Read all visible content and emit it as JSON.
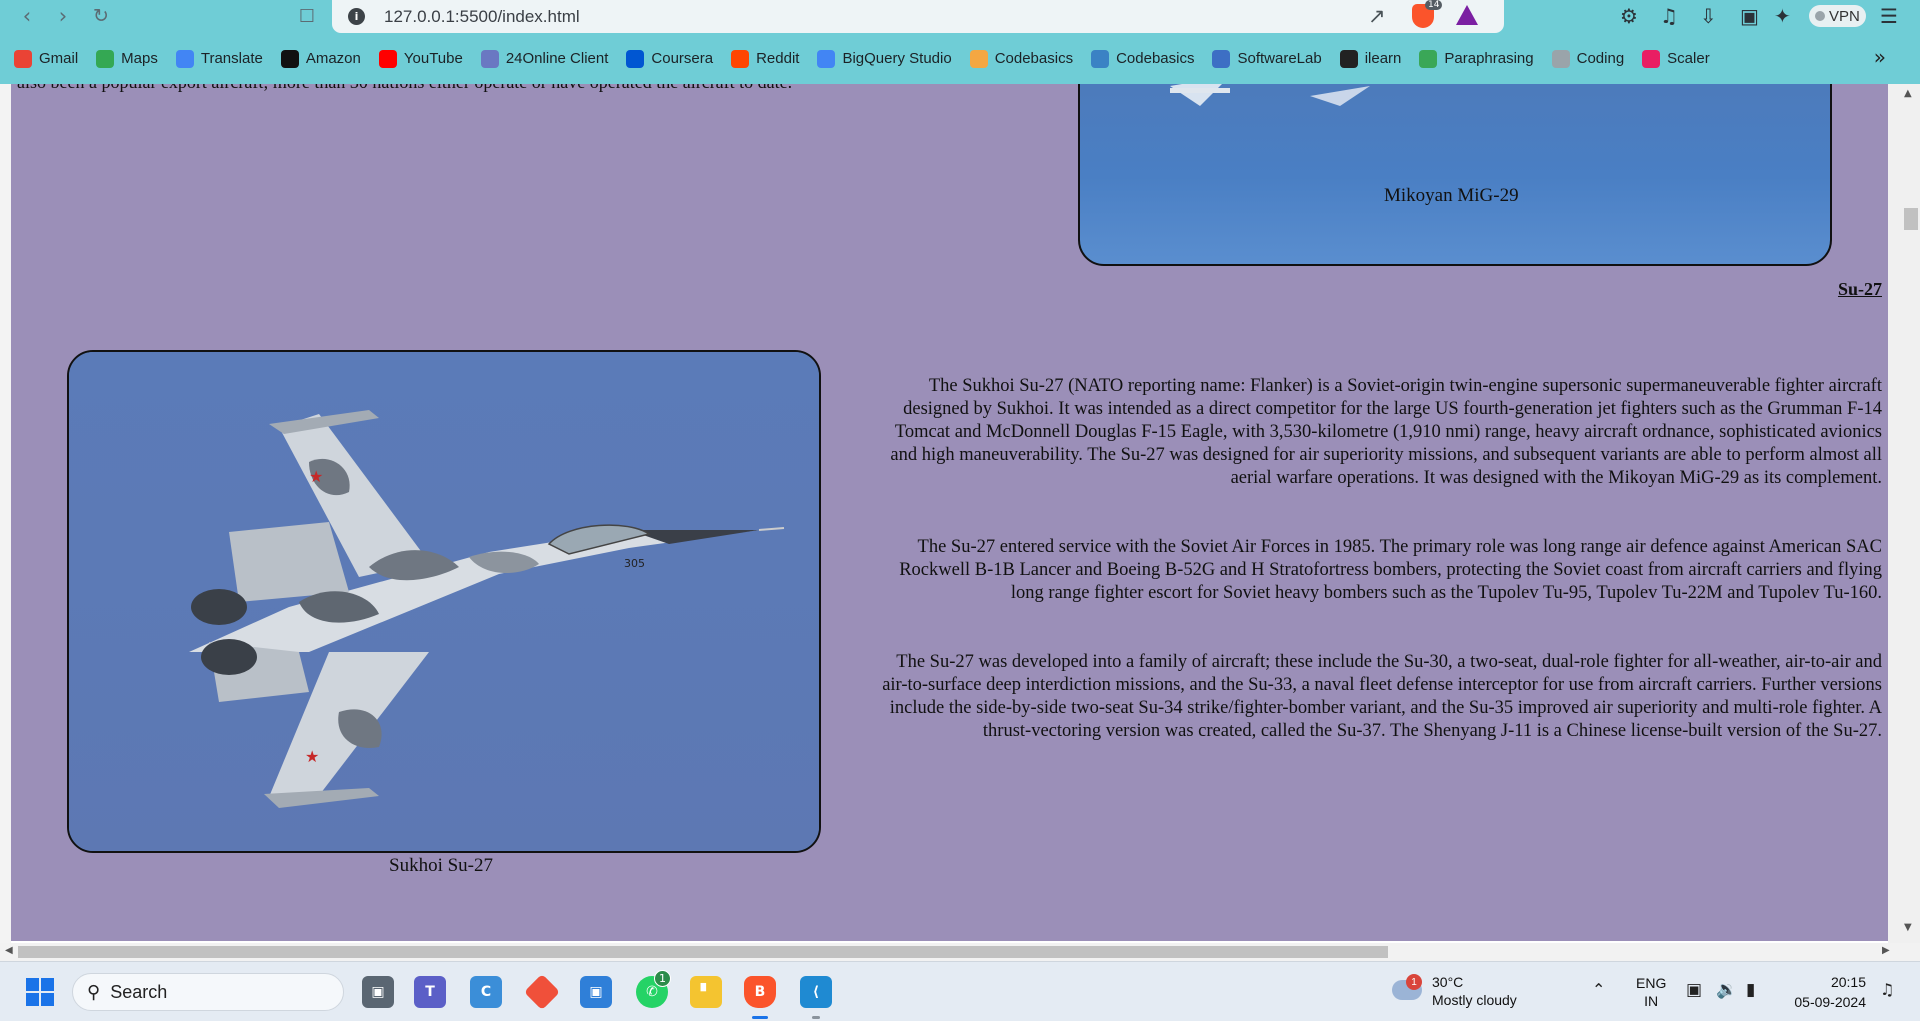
{
  "browser": {
    "url": "127.0.0.1:5500/index.html",
    "brave_badge_count": "14",
    "vpn_label": "VPN"
  },
  "bookmarks": [
    {
      "label": "Gmail",
      "icon": "gmail-icon",
      "color": "#ea4335"
    },
    {
      "label": "Maps",
      "icon": "maps-icon",
      "color": "#34a853"
    },
    {
      "label": "Translate",
      "icon": "translate-icon",
      "color": "#4285f4"
    },
    {
      "label": "Amazon",
      "icon": "amazon-icon",
      "color": "#111111"
    },
    {
      "label": "YouTube",
      "icon": "youtube-icon",
      "color": "#ff0000"
    },
    {
      "label": "24Online Client",
      "icon": "24online-icon",
      "color": "#6a78c2"
    },
    {
      "label": "Coursera",
      "icon": "coursera-icon",
      "color": "#0056d2"
    },
    {
      "label": "Reddit",
      "icon": "reddit-icon",
      "color": "#ff4500"
    },
    {
      "label": "BigQuery Studio",
      "icon": "bigquery-icon",
      "color": "#4285f4"
    },
    {
      "label": "Codebasics",
      "icon": "rocket-icon",
      "color": "#f4a742"
    },
    {
      "label": "Codebasics",
      "icon": "codebasics-icon",
      "color": "#3b82c4"
    },
    {
      "label": "SoftwareLab",
      "icon": "softwarelab-icon",
      "color": "#3d6fc4"
    },
    {
      "label": "ilearn",
      "icon": "globe-icon",
      "color": "#222222"
    },
    {
      "label": "Paraphrasing",
      "icon": "paraphrasing-icon",
      "color": "#3aa757"
    },
    {
      "label": "Coding",
      "icon": "coding-icon",
      "color": "#9aa4aa"
    },
    {
      "label": "Scaler",
      "icon": "scaler-icon",
      "color": "#e91e63"
    }
  ],
  "page": {
    "cut_text": "also been a popular export aircraft; more than 30 nations either operate or have operated the aircraft to date.",
    "mig_caption": "Mikoyan MiG-29",
    "su_heading": "Su-27",
    "su_caption": "Sukhoi Su-27",
    "paragraphs": [
      "The Sukhoi Su-27 (NATO reporting name: Flanker) is a Soviet-origin twin-engine supersonic supermaneuverable fighter aircraft designed by Sukhoi. It was intended as a direct competitor for the large US fourth-generation jet fighters such as the Grumman F-14 Tomcat and McDonnell Douglas F-15 Eagle, with 3,530-kilometre (1,910 nmi) range, heavy aircraft ordnance, sophisticated avionics and high maneuverability. The Su-27 was designed for air superiority missions, and subsequent variants are able to perform almost all aerial warfare operations. It was designed with the Mikoyan MiG-29 as its complement.",
      "The Su-27 entered service with the Soviet Air Forces in 1985. The primary role was long range air defence against American SAC Rockwell B-1B Lancer and Boeing B-52G and H Stratofortress bombers, protecting the Soviet coast from aircraft carriers and flying long range fighter escort for Soviet heavy bombers such as the Tupolev Tu-95, Tupolev Tu-22M and Tupolev Tu-160.",
      "The Su-27 was developed into a family of aircraft; these include the Su-30, a two-seat, dual-role fighter for all-weather, air-to-air and air-to-surface deep interdiction missions, and the Su-33, a naval fleet defense interceptor for use from aircraft carriers. Further versions include the side-by-side two-seat Su-34 strike/fighter-bomber variant, and the Su-35 improved air superiority and multi-role fighter. A thrust-vectoring version was created, called the Su-37. The Shenyang J-11 is a Chinese license-built version of the Su-27."
    ],
    "aircraft_tail_number": "305"
  },
  "taskbar": {
    "search_label": "Search",
    "whatsapp_badge": "1",
    "weather_badge": "1",
    "temperature": "30°C",
    "weather_desc": "Mostly cloudy",
    "lang_line1": "ENG",
    "lang_line2": "IN",
    "time": "20:15",
    "date": "05-09-2024"
  }
}
